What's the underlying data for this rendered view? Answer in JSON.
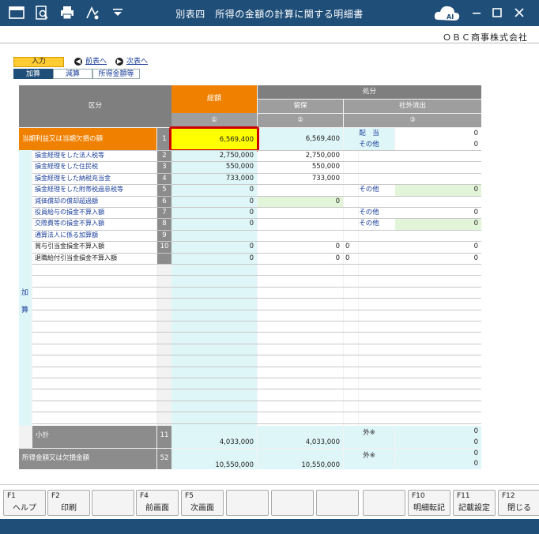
{
  "window": {
    "title": "別表四　所得の金額の計算に関する明細書"
  },
  "company": "ＯＢＣ商事株式会社",
  "mode": "入力",
  "nav": {
    "prev": "前表へ",
    "next": "次表へ"
  },
  "tabs": [
    "加算",
    "減算",
    "所得金額等"
  ],
  "table": {
    "header": {
      "kubun": "区分",
      "total": "総額",
      "disposal": "処分",
      "retained": "留保",
      "outflow": "社外流出",
      "col1": "①",
      "col2": "②",
      "col3": "③"
    },
    "top_row": {
      "label": "当期利益又は当期欠損の額",
      "no": "1",
      "total": "6,569,400",
      "retained": "6,569,400",
      "out_label1": "配　当",
      "out_value1": "0",
      "out_label2": "その他",
      "out_value2": "0"
    },
    "side_label": "加　算",
    "rows": [
      {
        "no": "2",
        "label": "損金経理をした法人税等",
        "total": "2,750,000",
        "retained": "2,750,000",
        "out_label": "",
        "out_value": ""
      },
      {
        "no": "3",
        "label": "損金経理をした住民税",
        "total": "550,000",
        "retained": "550,000",
        "out_label": "",
        "out_value": ""
      },
      {
        "no": "4",
        "label": "損金経理をした納税充当金",
        "total": "733,000",
        "retained": "733,000",
        "out_label": "",
        "out_value": ""
      },
      {
        "no": "5",
        "label": "損金経理をした附帯税過怠税等",
        "total": "0",
        "retained": "",
        "out_label": "その他",
        "out_value": "0"
      },
      {
        "no": "6",
        "label": "減価償却の償却超過額",
        "total": "0",
        "retained": "0",
        "out_label": "",
        "out_value": ""
      },
      {
        "no": "7",
        "label": "役員給与の損金不算入額",
        "total": "0",
        "retained": "",
        "out_label": "その他",
        "out_value": "0"
      },
      {
        "no": "8",
        "label": "交際費等の損金不算入額",
        "total": "0",
        "retained": "",
        "out_label": "その他",
        "out_value": "0"
      },
      {
        "no": "9",
        "label": "通算法人に係る加算額",
        "total": "",
        "retained": "",
        "out_label": "",
        "out_value": ""
      },
      {
        "no": "10",
        "label": "賞与引当金損金不算入額",
        "total": "0",
        "retained": "0",
        "out_label": "0",
        "out_value": "0"
      },
      {
        "no": "",
        "label": "退職給付引当金損金不算入額",
        "total": "0",
        "retained": "0",
        "out_label": "0",
        "out_value": "0"
      }
    ],
    "subtotal": {
      "label": "小計",
      "no": "11",
      "total": "4,033,000",
      "retained": "4,033,000",
      "out_mark": "外※",
      "out_value1": "0",
      "out_value2": "0"
    },
    "income": {
      "label": "所得金額又は欠損金額",
      "no": "52",
      "total": "10,550,000",
      "retained": "10,550,000",
      "out_mark": "外※",
      "out_value1": "0",
      "out_value2": "0"
    }
  },
  "fkeys": [
    {
      "key": "F1",
      "label": "ヘルプ"
    },
    {
      "key": "F2",
      "label": "印刷"
    },
    {
      "key": "",
      "label": ""
    },
    {
      "key": "F4",
      "label": "前画面"
    },
    {
      "key": "F5",
      "label": "次画面"
    },
    {
      "key": "",
      "label": ""
    },
    {
      "key": "",
      "label": ""
    },
    {
      "key": "",
      "label": ""
    },
    {
      "key": "",
      "label": ""
    },
    {
      "key": "F10",
      "label": "明細転記"
    },
    {
      "key": "F11",
      "label": "記載設定"
    },
    {
      "key": "F12",
      "label": "閉じる"
    }
  ],
  "colors": {
    "accent": "#1f4e79",
    "orange": "#f08000",
    "highlight_border": "#cc0000"
  }
}
